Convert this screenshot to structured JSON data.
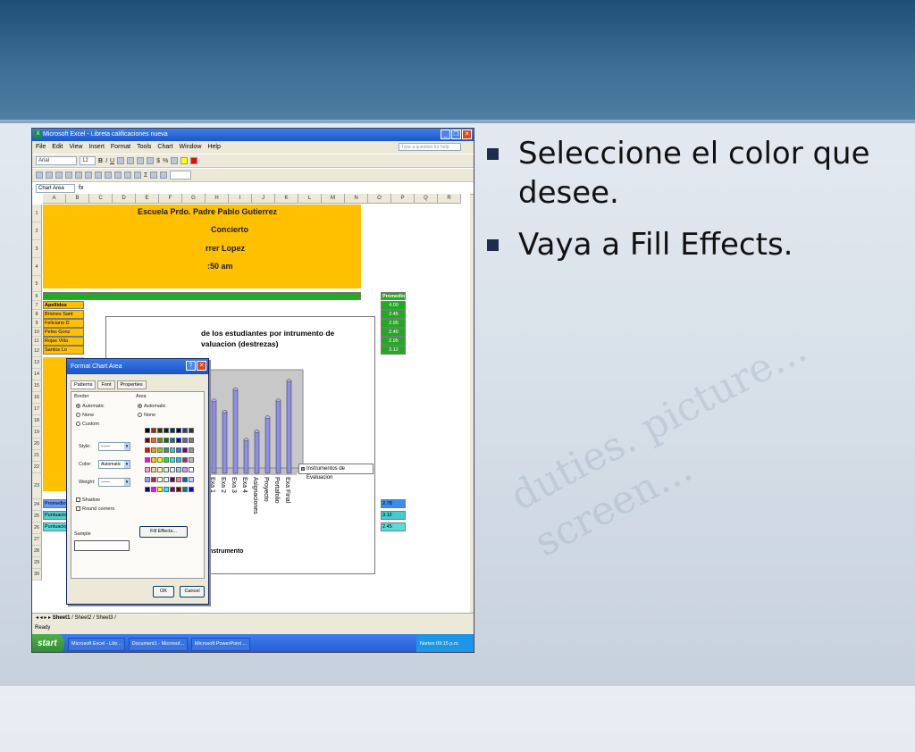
{
  "slide": {
    "bullets": [
      "Seleccione el color que desee.",
      "Vaya a Fill Effects."
    ],
    "watermark": "duties. picture... screen..."
  },
  "excel": {
    "window_title": "Microsoft Excel - Libreta calificaciones nueva",
    "menu": [
      "File",
      "Edit",
      "View",
      "Insert",
      "Format",
      "Tools",
      "Chart",
      "Window",
      "Help"
    ],
    "help_placeholder": "Type a question for help",
    "font_name": "Arial",
    "font_size": "12",
    "name_box": "Chart Area",
    "fx": "fx",
    "columns": [
      "A",
      "B",
      "C",
      "D",
      "E",
      "F",
      "G",
      "H",
      "I",
      "J",
      "K",
      "L",
      "M",
      "N",
      "O",
      "P",
      "Q",
      "R"
    ],
    "rows": [
      "1",
      "2",
      "3",
      "4",
      "5",
      "6",
      "7",
      "8",
      "9",
      "10",
      "11",
      "12",
      "13",
      "14",
      "15",
      "16",
      "17",
      "18",
      "19",
      "20",
      "21",
      "22",
      "23",
      "24",
      "25",
      "26",
      "27",
      "28",
      "29",
      "30"
    ],
    "header_block": {
      "line1": "Escuela Prdo. Padre Pablo Gutierrez",
      "line2": "Concierto",
      "line3": "rrer Lopez",
      "line4": ":50 am"
    },
    "row6_labels": [
      "Apellidos",
      "Promedio"
    ],
    "names": [
      "Briones Sant",
      "Feliciano D",
      "Peles Gonz",
      "Rojas Villa",
      "Santos Lo"
    ],
    "averages": [
      "4.00",
      "2.45",
      "2.95",
      "2.45",
      "2.95",
      "3.12"
    ],
    "summary_labels": [
      "Promedio del Grupo",
      "Puntuacion Max",
      "Puntuacion Min."
    ],
    "summary_values": [
      "2.78",
      "3.12",
      "2.45"
    ],
    "sheet_tabs": [
      "Sheet1",
      "Sheet2",
      "Sheet3"
    ],
    "status": "Ready"
  },
  "chart_data": {
    "type": "bar",
    "title": "de los estudiantes por intrumento de valuacion (destrezas)",
    "categories": [
      "Exa 1",
      "Exa 2",
      "Exa 3",
      "Exa 4",
      "Asignaciones",
      "Proyecto",
      "Portafolio",
      "Exa Final"
    ],
    "values": [
      2.6,
      2.2,
      3.0,
      1.2,
      1.5,
      2.0,
      2.6,
      3.3
    ],
    "series": [
      {
        "name": "Instrumentos de Evaluacion",
        "values": [
          2.6,
          2.2,
          3.0,
          1.2,
          1.5,
          2.0,
          2.6,
          3.3
        ]
      }
    ],
    "xlabel": "Instrumento",
    "legend": "right",
    "colors": {
      "bar": "#8e8ee6"
    }
  },
  "dialog": {
    "title": "Format Chart Area",
    "tabs": [
      "Patterns",
      "Font",
      "Properties"
    ],
    "border_label": "Border",
    "border_options": [
      "Automatic",
      "None",
      "Custom"
    ],
    "style_label": "Style:",
    "color_label": "Color:",
    "color_value": "Automatic",
    "weight_label": "Weight:",
    "shadow": "Shadow",
    "rounded": "Round corners",
    "area_label": "Area",
    "area_options": [
      "Automatic",
      "None"
    ],
    "fill_effects": "Fill Effects...",
    "sample": "Sample",
    "ok": "OK",
    "cancel": "Cancel"
  },
  "taskbar": {
    "start": "start",
    "tasks": [
      "Microsoft Excel - Libr...",
      "Document1 - Microsof...",
      "Microsoft PowerPoint ..."
    ],
    "norton": "Norton",
    "clock": "09:15 p.m."
  },
  "palette_colors": [
    [
      "#000000",
      "#993300",
      "#333300",
      "#003300",
      "#003366",
      "#000080",
      "#333399",
      "#333333"
    ],
    [
      "#800000",
      "#ff6600",
      "#808000",
      "#008000",
      "#008080",
      "#0000ff",
      "#666699",
      "#808080"
    ],
    [
      "#ff0000",
      "#ff9900",
      "#99cc00",
      "#339966",
      "#33cccc",
      "#3366ff",
      "#800080",
      "#969696"
    ],
    [
      "#ff00ff",
      "#ffcc00",
      "#ffff00",
      "#00ff00",
      "#00ffff",
      "#00ccff",
      "#993366",
      "#c0c0c0"
    ],
    [
      "#ff99cc",
      "#ffcc99",
      "#ffff99",
      "#ccffcc",
      "#ccffff",
      "#99ccff",
      "#cc99ff",
      "#ffffff"
    ],
    [
      "#9999ff",
      "#993366",
      "#ffffcc",
      "#ccffff",
      "#660066",
      "#ff8080",
      "#0066cc",
      "#ccccff"
    ],
    [
      "#000080",
      "#ff00ff",
      "#ffff00",
      "#00ffff",
      "#800080",
      "#800000",
      "#008080",
      "#0000ff"
    ]
  ]
}
